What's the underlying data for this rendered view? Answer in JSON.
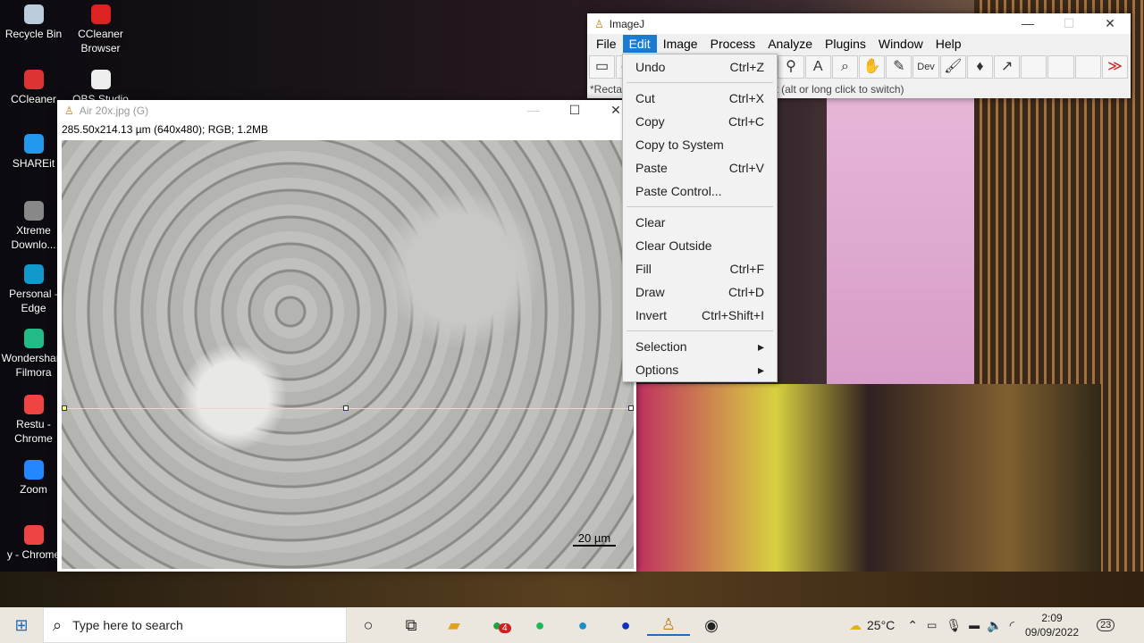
{
  "desktop": {
    "icons": [
      "Recycle Bin",
      "CCleaner Browser",
      "CCleaner",
      "OBS Studio",
      "SHAREit",
      "Xtreme Downlo...",
      "Personal - Edge",
      "Wondershare Filmora",
      "Restu - Chrome",
      "Zoom",
      "y - Chrome"
    ]
  },
  "imagej": {
    "title": "ImageJ",
    "menus": [
      "File",
      "Edit",
      "Image",
      "Process",
      "Analyze",
      "Plugins",
      "Window",
      "Help"
    ],
    "active_menu": "Edit",
    "tools": [
      "rectangle",
      "oval",
      "polygon",
      "freehand",
      "line",
      "angle",
      "point",
      "wand",
      "text",
      "magnifier",
      "hand",
      "color-picker",
      "Dev",
      "brush",
      "flood-fill",
      "arrow",
      "",
      "",
      "",
      "more"
    ],
    "status": "*Rectangle, rounded rect or rotated rect (alt or long click to switch)"
  },
  "edit_menu": {
    "items": [
      {
        "label": "Undo",
        "shortcut": "Ctrl+Z"
      },
      {
        "sep": true
      },
      {
        "label": "Cut",
        "shortcut": "Ctrl+X"
      },
      {
        "label": "Copy",
        "shortcut": "Ctrl+C"
      },
      {
        "label": "Copy to System",
        "shortcut": ""
      },
      {
        "label": "Paste",
        "shortcut": "Ctrl+V"
      },
      {
        "label": "Paste Control...",
        "shortcut": ""
      },
      {
        "sep": true
      },
      {
        "label": "Clear",
        "shortcut": ""
      },
      {
        "label": "Clear Outside",
        "shortcut": ""
      },
      {
        "label": "Fill",
        "shortcut": "Ctrl+F"
      },
      {
        "label": "Draw",
        "shortcut": "Ctrl+D"
      },
      {
        "label": "Invert",
        "shortcut": "Ctrl+Shift+I"
      },
      {
        "sep": true
      },
      {
        "label": "Selection",
        "shortcut": "▸"
      },
      {
        "label": "Options",
        "shortcut": "▸"
      }
    ]
  },
  "image_window": {
    "title": "Air 20x.jpg (G)",
    "info": "285.50x214.13 µm (640x480); RGB; 1.2MB",
    "scale_bar": "20 µm",
    "line_color": "#f0f040"
  },
  "taskbar": {
    "search_placeholder": "Type here to search",
    "weather": "25°C",
    "time": "2:09",
    "date": "09/09/2022",
    "notifications": "23",
    "whatsapp_badge": "4"
  }
}
